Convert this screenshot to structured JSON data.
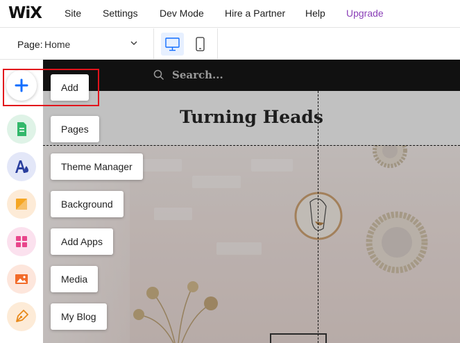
{
  "topbar": {
    "logo": "WiX",
    "menu": [
      "Site",
      "Settings",
      "Dev Mode",
      "Hire a Partner",
      "Help",
      "Upgrade"
    ]
  },
  "pagebar": {
    "page_prefix": "Page:",
    "page_value": "Home"
  },
  "canvas": {
    "search_placeholder": "Search...",
    "site_title": "Turning Heads"
  },
  "add_panel": {
    "items": [
      "Add",
      "Pages",
      "Theme Manager",
      "Background",
      "Add Apps",
      "Media",
      "My Blog"
    ]
  },
  "colors": {
    "upgrade": "#8a3fb7",
    "highlight": "#e2131b",
    "add_blue": "#116dff"
  },
  "icons": [
    "plus-icon",
    "pages-icon",
    "theme-icon",
    "background-icon",
    "apps-icon",
    "media-icon",
    "blog-icon",
    "desktop-icon",
    "mobile-icon",
    "search-icon",
    "chevron-down-icon"
  ]
}
